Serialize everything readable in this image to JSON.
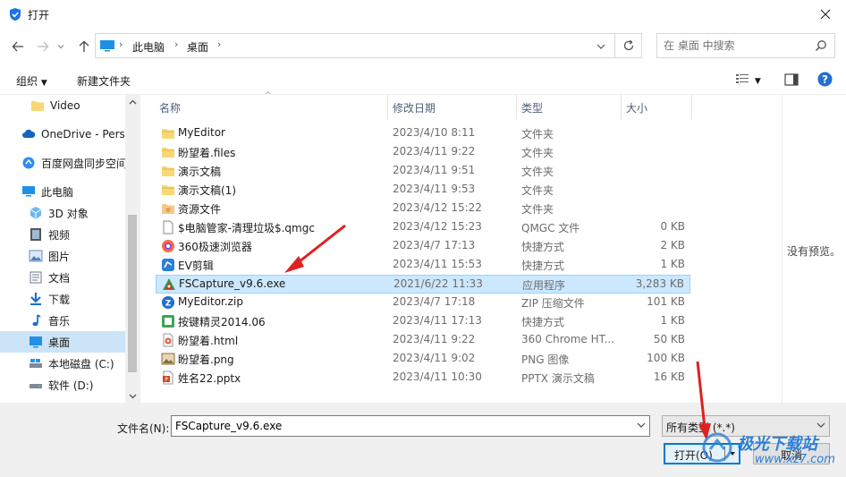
{
  "window": {
    "title": "打开"
  },
  "nav": {
    "breadcrumbs": [
      "此电脑",
      "桌面"
    ],
    "search_placeholder": "在 桌面 中搜索"
  },
  "toolbar": {
    "organize": "组织",
    "new_folder": "新建文件夹"
  },
  "sidebar": {
    "items": [
      {
        "label": "Video",
        "icon": "folder-icon"
      },
      {
        "label": "OneDrive - Perso",
        "icon": "cloud-icon"
      },
      {
        "label": "百度网盘同步空间",
        "icon": "baidu-netdisk-icon"
      },
      {
        "label": "此电脑",
        "icon": "computer-icon"
      },
      {
        "label": "3D 对象",
        "icon": "3d-objects-icon"
      },
      {
        "label": "视频",
        "icon": "video-folder-icon"
      },
      {
        "label": "图片",
        "icon": "pictures-icon"
      },
      {
        "label": "文档",
        "icon": "documents-icon"
      },
      {
        "label": "下载",
        "icon": "download-icon"
      },
      {
        "label": "音乐",
        "icon": "music-icon"
      },
      {
        "label": "桌面",
        "icon": "desktop-icon"
      },
      {
        "label": "本地磁盘 (C:)",
        "icon": "drive-c-icon"
      },
      {
        "label": "软件 (D:)",
        "icon": "drive-d-icon"
      }
    ],
    "active_label": "桌面"
  },
  "columns": {
    "name": "名称",
    "modified": "修改日期",
    "type": "类型",
    "size": "大小"
  },
  "files": [
    {
      "name": "MyEditor",
      "date": "2023/4/10 8:11",
      "type": "文件夹",
      "size": "",
      "icon": "folder-icon"
    },
    {
      "name": "盼望着.files",
      "date": "2023/4/11 9:22",
      "type": "文件夹",
      "size": "",
      "icon": "folder-icon"
    },
    {
      "name": "演示文稿",
      "date": "2023/4/11 9:51",
      "type": "文件夹",
      "size": "",
      "icon": "folder-icon"
    },
    {
      "name": "演示文稿(1)",
      "date": "2023/4/11 9:53",
      "type": "文件夹",
      "size": "",
      "icon": "folder-icon"
    },
    {
      "name": "资源文件",
      "date": "2023/4/12 15:22",
      "type": "文件夹",
      "size": "",
      "icon": "special-folder-icon"
    },
    {
      "name": "$电脑管家-清理垃圾$.qmgc",
      "date": "2023/4/12 15:23",
      "type": "QMGC 文件",
      "size": "0 KB",
      "icon": "blank-file-icon"
    },
    {
      "name": "360极速浏览器",
      "date": "2023/4/7 17:13",
      "type": "快捷方式",
      "size": "2 KB",
      "icon": "360-browser-icon"
    },
    {
      "name": "EV剪辑",
      "date": "2023/4/11 15:53",
      "type": "快捷方式",
      "size": "1 KB",
      "icon": "ev-editor-icon"
    },
    {
      "name": "FSCapture_v9.6.exe",
      "date": "2021/6/22 11:33",
      "type": "应用程序",
      "size": "3,283 KB",
      "icon": "fscapture-icon"
    },
    {
      "name": "MyEditor.zip",
      "date": "2023/4/7 17:18",
      "type": "ZIP 压缩文件",
      "size": "101 KB",
      "icon": "zip-icon"
    },
    {
      "name": "按键精灵2014.06",
      "date": "2023/4/11 17:13",
      "type": "快捷方式",
      "size": "1 KB",
      "icon": "anjian-icon"
    },
    {
      "name": "盼望着.html",
      "date": "2023/4/11 9:22",
      "type": "360 Chrome HT...",
      "size": "50 KB",
      "icon": "html-icon"
    },
    {
      "name": "盼望着.png",
      "date": "2023/4/11 9:02",
      "type": "PNG 图像",
      "size": "100 KB",
      "icon": "png-icon"
    },
    {
      "name": "姓名22.pptx",
      "date": "2023/4/11 10:30",
      "type": "PPTX 演示文稿",
      "size": "16 KB",
      "icon": "pptx-icon"
    }
  ],
  "selected_file": "FSCapture_v9.6.exe",
  "preview": {
    "empty_text": "没有预览。"
  },
  "footer": {
    "filename_label": "文件名(N):",
    "filename_value": "FSCapture_v9.6.exe",
    "filetype_value": "所有类型 (*.*)",
    "open_label": "打开(O)",
    "cancel_label": "取消"
  },
  "watermark": {
    "text1": "极光下载站",
    "text2": "www.xz7.com"
  },
  "colors": {
    "accent": "#0078d7",
    "selection": "#cce8ff",
    "folder": "#f8d775",
    "annotation_arrow": "#e02020"
  }
}
